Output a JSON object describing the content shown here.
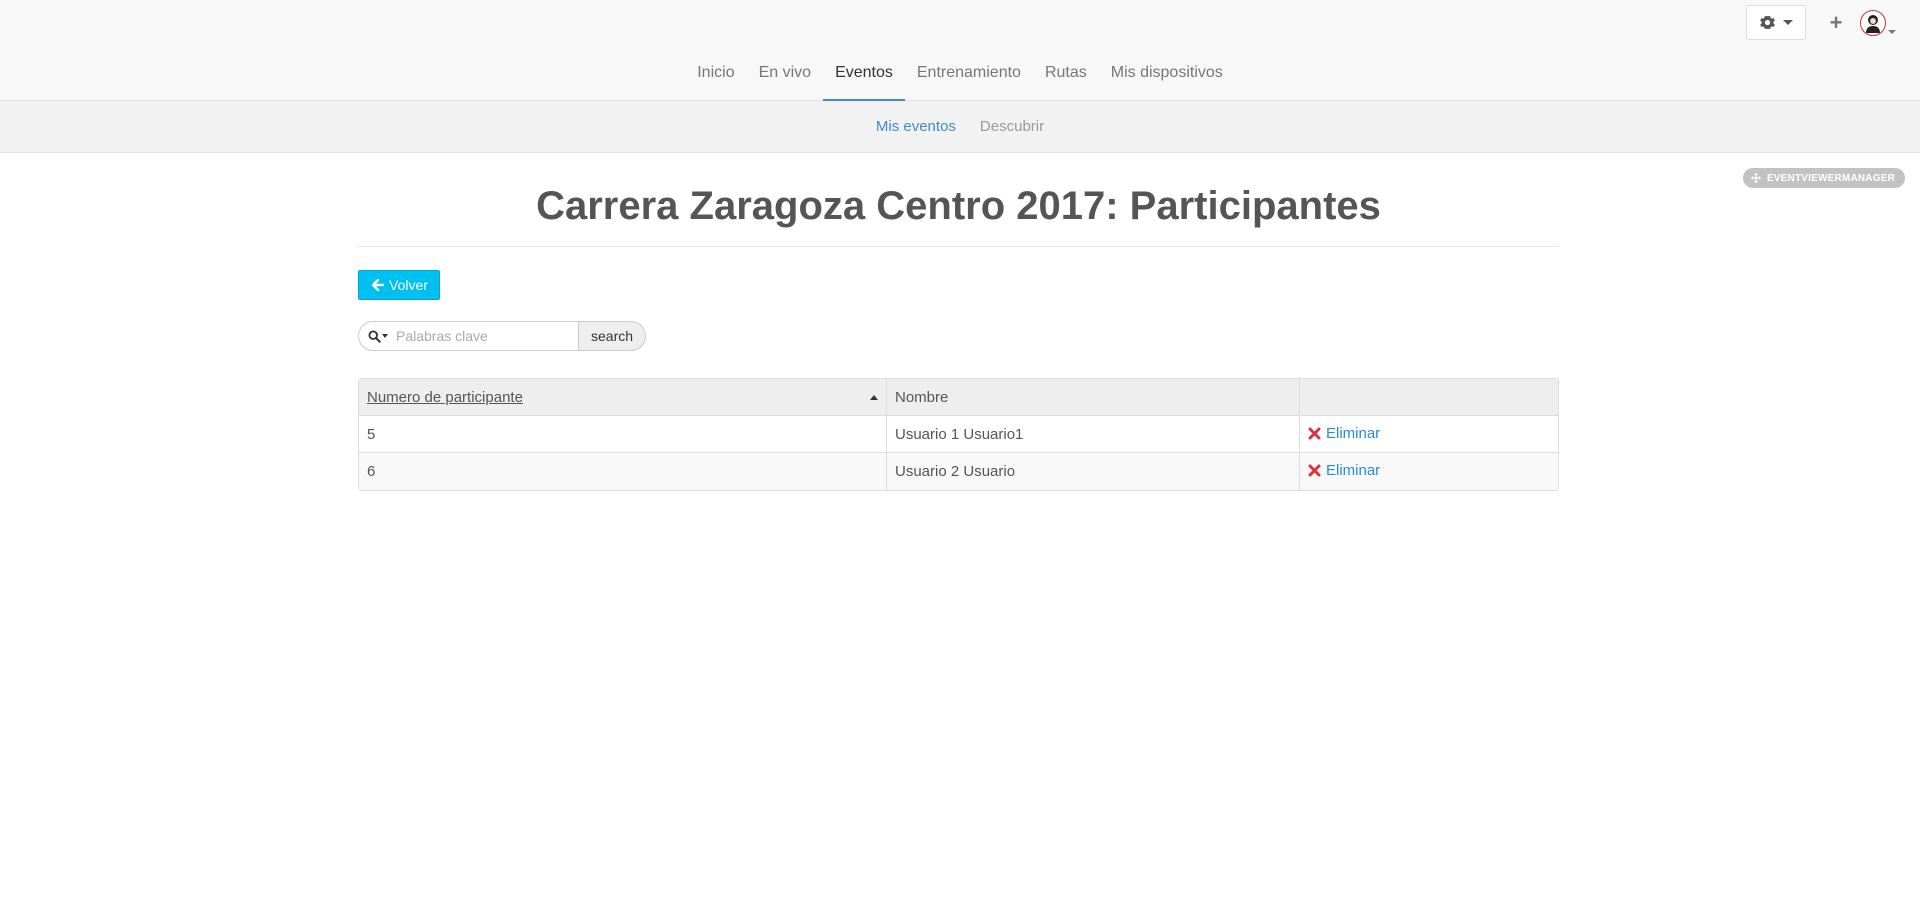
{
  "header": {
    "nav": [
      {
        "label": "Inicio",
        "active": false
      },
      {
        "label": "En vivo",
        "active": false
      },
      {
        "label": "Eventos",
        "active": true
      },
      {
        "label": "Entrenamiento",
        "active": false
      },
      {
        "label": "Rutas",
        "active": false
      },
      {
        "label": "Mis dispositivos",
        "active": false
      }
    ],
    "tools": {
      "settings_icon": "gear-icon",
      "add_icon": "plus-icon",
      "add_label": "+",
      "avatar_icon": "user-avatar"
    }
  },
  "subnav": [
    {
      "label": "Mis eventos",
      "active": true
    },
    {
      "label": "Descubrir",
      "active": false
    }
  ],
  "manager_badge": "EVENTVIEWERMANAGER",
  "page": {
    "title": "Carrera Zaragoza Centro 2017: Participantes",
    "back_label": "Volver",
    "search": {
      "placeholder": "Palabras clave",
      "value": "",
      "button_label": "search"
    }
  },
  "table": {
    "columns": [
      "Numero de participante",
      "Nombre",
      ""
    ],
    "sorted_column": "Numero de participante",
    "sort_direction": "asc",
    "rows": [
      {
        "number": "5",
        "name": "Usuario 1 Usuario1",
        "action": "Eliminar"
      },
      {
        "number": "6",
        "name": "Usuario 2 Usuario",
        "action": "Eliminar"
      }
    ]
  },
  "colors": {
    "accent": "#428bca",
    "back_button": "#00c0f0",
    "delete_icon": "#e0303c",
    "link": "#2a8bd5"
  }
}
